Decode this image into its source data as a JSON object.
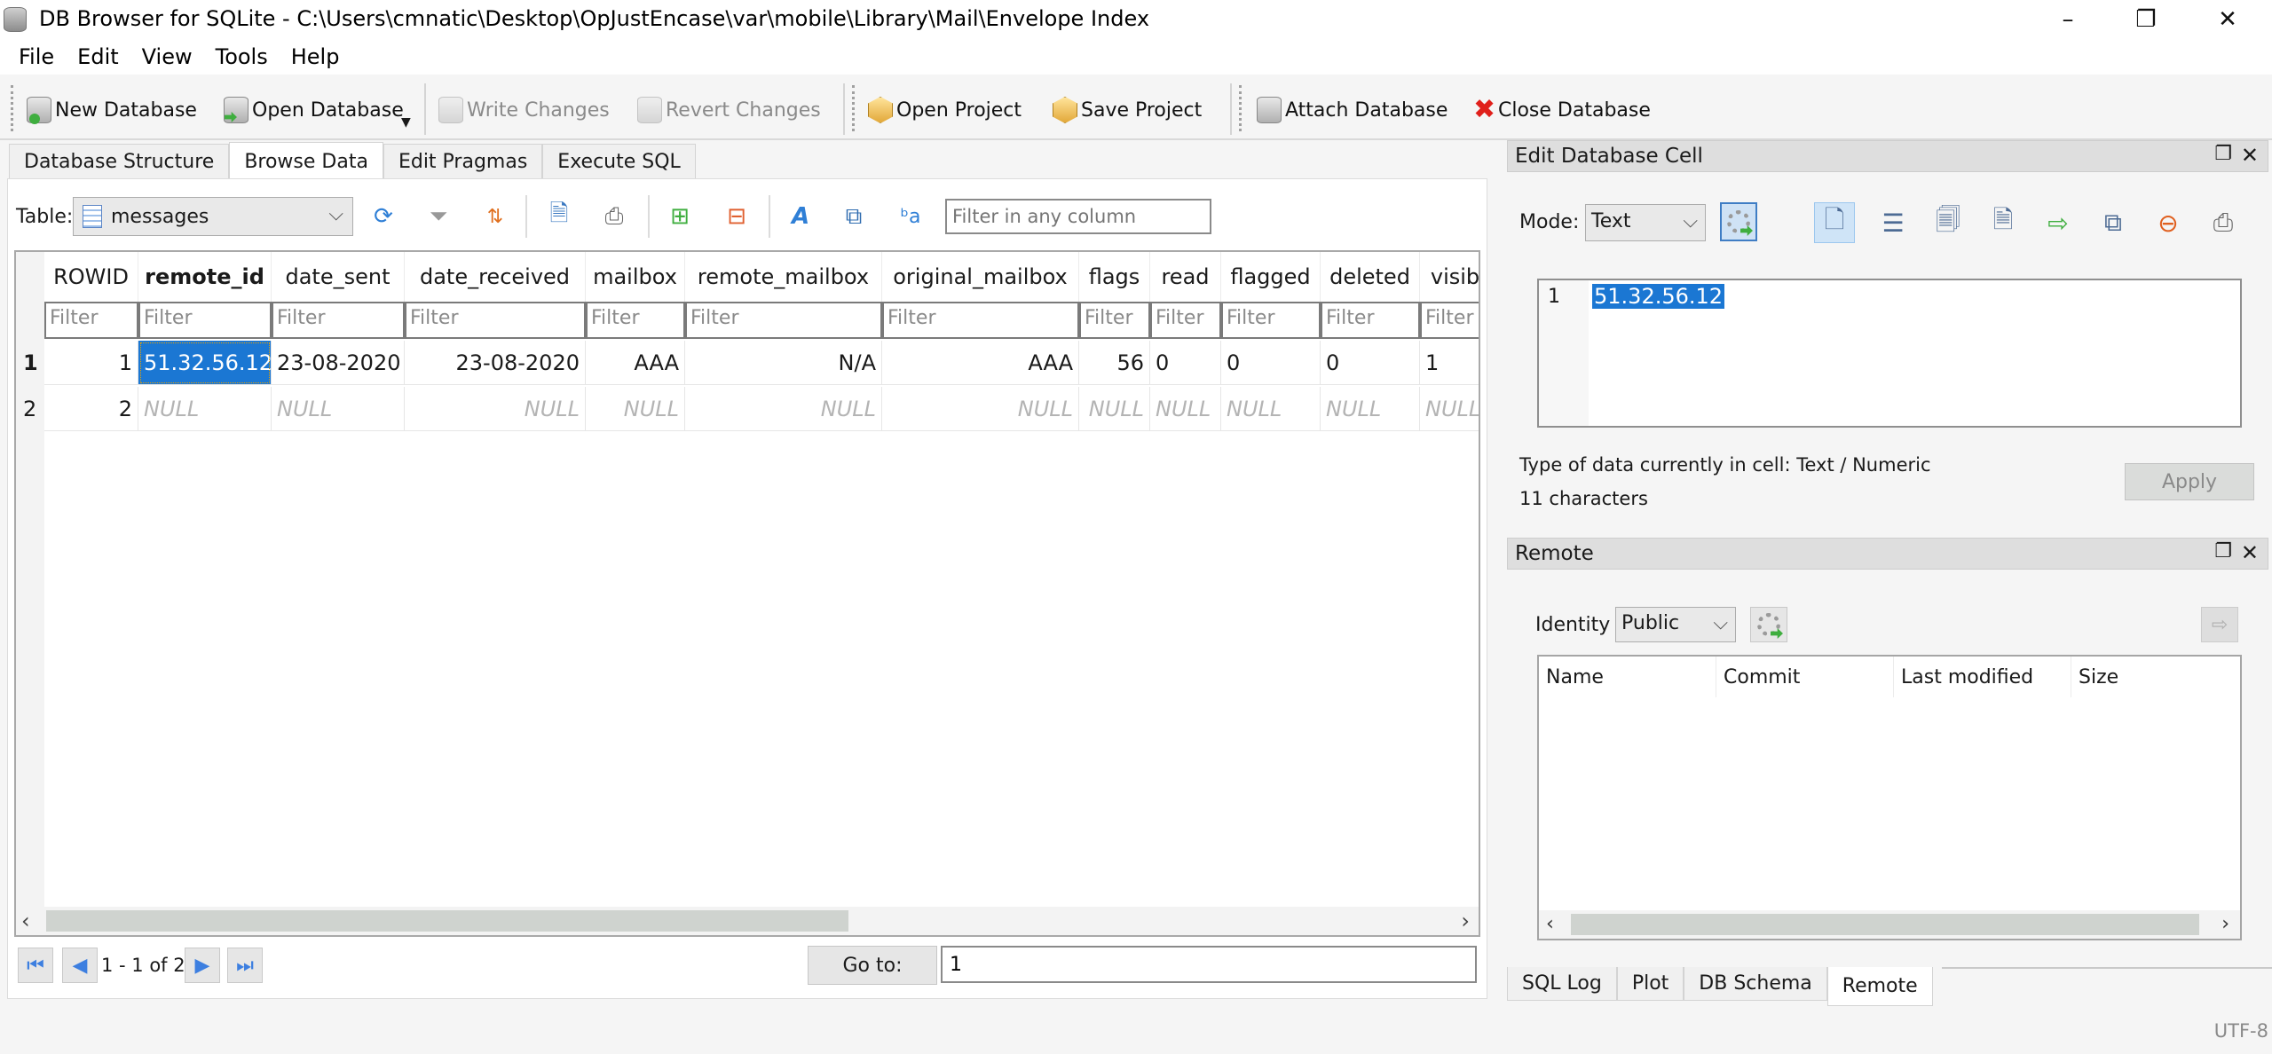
{
  "window": {
    "title": "DB Browser for SQLite - C:\\Users\\cmnatic\\Desktop\\OpJustEncase\\var\\mobile\\Library\\Mail\\Envelope Index",
    "minimize": "–",
    "restore": "❐",
    "close": "✕"
  },
  "menu": [
    "File",
    "Edit",
    "View",
    "Tools",
    "Help"
  ],
  "toolbar": {
    "new_database": "New Database",
    "open_database": "Open Database",
    "write_changes": "Write Changes",
    "revert_changes": "Revert Changes",
    "open_project": "Open Project",
    "save_project": "Save Project",
    "attach_database": "Attach Database",
    "close_database": "Close Database"
  },
  "main_tabs": [
    {
      "label": "Database Structure",
      "active": false
    },
    {
      "label": "Browse Data",
      "active": true
    },
    {
      "label": "Edit Pragmas",
      "active": false
    },
    {
      "label": "Execute SQL",
      "active": false
    }
  ],
  "browse": {
    "table_label": "Table:",
    "table_selected": "messages",
    "filter_placeholder": "Filter in any column",
    "icons": [
      "refresh-icon",
      "clear-filters-icon",
      "sort-icon",
      "save-table-icon",
      "print-icon",
      "insert-record-icon",
      "delete-record-icon",
      "find-icon",
      "find-replace-icon",
      "set-encoding-icon"
    ]
  },
  "grid": {
    "columns": [
      "ROWID",
      "remote_id",
      "date_sent",
      "date_received",
      "mailbox",
      "remote_mailbox",
      "original_mailbox",
      "flags",
      "read",
      "flagged",
      "deleted",
      "visib"
    ],
    "primary_key_column": "remote_id",
    "filter_placeholder": "Filter",
    "rows": [
      {
        "num": "1",
        "cells": [
          "1",
          "51.32.56.12",
          "23-08-2020",
          "23-08-2020",
          "AAA",
          "N/A",
          "AAA",
          "56",
          "0",
          "0",
          "0",
          "1"
        ]
      },
      {
        "num": "2",
        "cells": [
          "2",
          "NULL",
          "NULL",
          "NULL",
          "NULL",
          "NULL",
          "NULL",
          "NULL",
          "NULL",
          "NULL",
          "NULL",
          "NULL"
        ]
      }
    ],
    "selected_cell": {
      "row": 1,
      "column": "remote_id"
    }
  },
  "pager": {
    "info": "1 - 1 of 2",
    "goto_label": "Go to:",
    "goto_value": "1"
  },
  "edit_cell": {
    "title": "Edit Database Cell",
    "mode_label": "Mode:",
    "mode_value": "Text",
    "line_number": "1",
    "value": "51.32.56.12",
    "data_type": "Type of data currently in cell: Text / Numeric",
    "char_count": "11 characters",
    "apply_label": "Apply"
  },
  "remote": {
    "title": "Remote",
    "identity_label": "Identity",
    "identity_value": "Public",
    "columns": [
      "Name",
      "Commit",
      "Last modified",
      "Size"
    ]
  },
  "dock_tabs": [
    {
      "label": "SQL Log",
      "active": false
    },
    {
      "label": "Plot",
      "active": false
    },
    {
      "label": "DB Schema",
      "active": false
    },
    {
      "label": "Remote",
      "active": true
    }
  ],
  "status": {
    "encoding": "UTF-8"
  },
  "colors": {
    "selection": "#1b77d3",
    "null_text": "#b4b4b4",
    "dock_title_bg": "#dedede"
  }
}
